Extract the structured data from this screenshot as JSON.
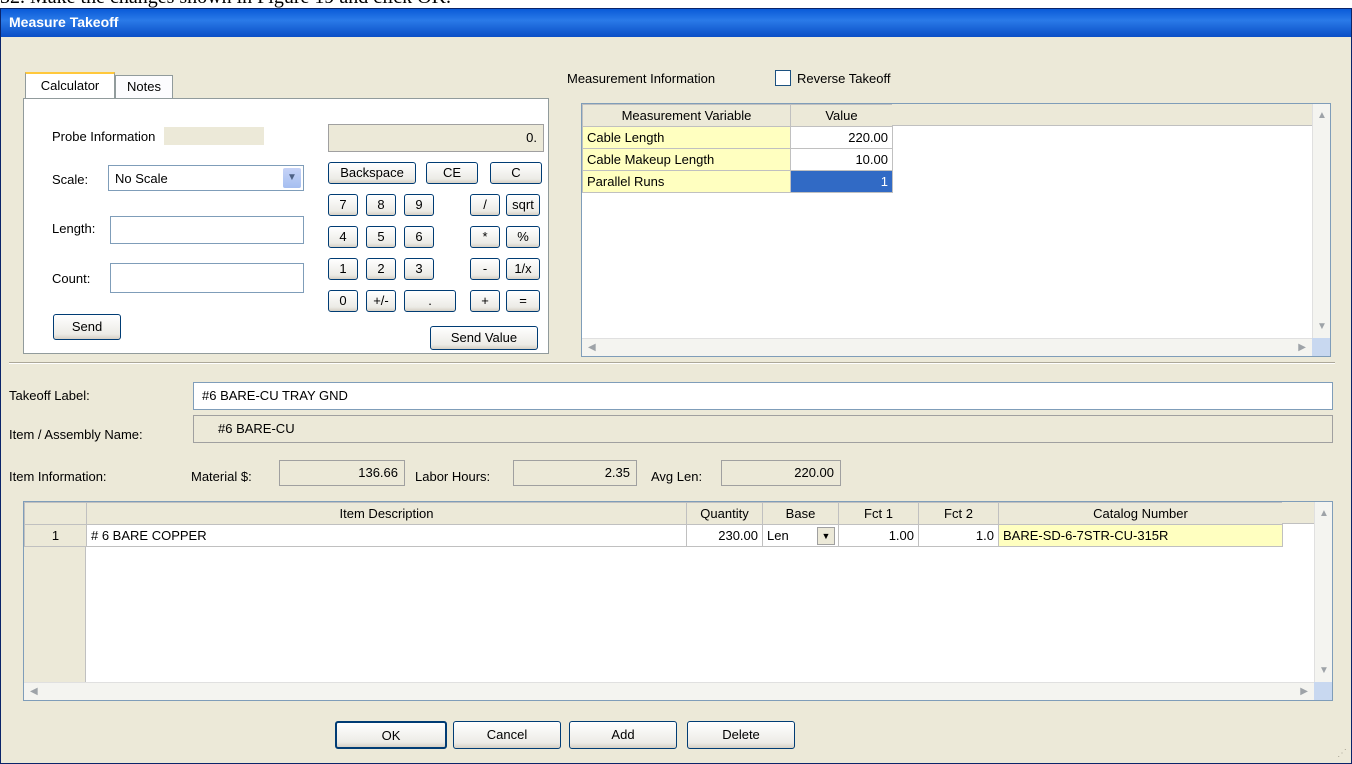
{
  "caption": "32. Make the changes shown in Figure 19 and click OK.",
  "window": {
    "title": "Measure Takeoff"
  },
  "tabs": [
    "Calculator",
    "Notes"
  ],
  "calculator": {
    "probe_label": "Probe Information",
    "display": "0.",
    "scale_label": "Scale:",
    "scale_value": "No Scale",
    "length_label": "Length:",
    "length_value": "",
    "count_label": "Count:",
    "count_value": "",
    "send_label": "Send",
    "send_value_label": "Send Value",
    "row1": [
      "Backspace",
      "CE",
      "C"
    ],
    "row2": [
      "7",
      "8",
      "9",
      "/",
      "sqrt"
    ],
    "row3": [
      "4",
      "5",
      "6",
      "*",
      "%"
    ],
    "row4": [
      "1",
      "2",
      "3",
      "-",
      "1/x"
    ],
    "row5": [
      "0",
      "+/-",
      ".",
      "+",
      "="
    ]
  },
  "measurement": {
    "title": "Measurement Information",
    "reverse_label": "Reverse Takeoff",
    "reverse_checked": false,
    "headers": [
      "Measurement Variable",
      "Value"
    ],
    "rows": [
      {
        "variable": "Cable Length",
        "value": "220.00"
      },
      {
        "variable": "Cable Makeup Length",
        "value": "10.00"
      },
      {
        "variable": "Parallel Runs",
        "value": "1"
      }
    ]
  },
  "takeoff": {
    "label_caption": "Takeoff Label:",
    "label_value": "#6 BARE-CU TRAY GND",
    "item_caption": "Item / Assembly Name:",
    "item_value": "#6 BARE-CU"
  },
  "item_info": {
    "caption": "Item Information:",
    "material_label": "Material $:",
    "material_value": "136.66",
    "labor_label": "Labor Hours:",
    "labor_value": "2.35",
    "avglen_label": "Avg Len:",
    "avglen_value": "220.00"
  },
  "items_table": {
    "headers": [
      "Item Description",
      "Quantity",
      "Base",
      "Fct 1",
      "Fct 2",
      "Catalog Number"
    ],
    "rows": [
      {
        "num": "1",
        "description": "# 6 BARE COPPER",
        "quantity": "230.00",
        "base": "Len",
        "fct1": "1.00",
        "fct2": "1.0",
        "catalog": "BARE-SD-6-7STR-CU-315R"
      }
    ]
  },
  "buttons": {
    "ok": "OK",
    "cancel": "Cancel",
    "add": "Add",
    "delete": "Delete"
  },
  "colors": {
    "title_bar": "#0a5bd8",
    "highlight_cell": "#ffffc0",
    "selected_cell": "#316ac5"
  }
}
